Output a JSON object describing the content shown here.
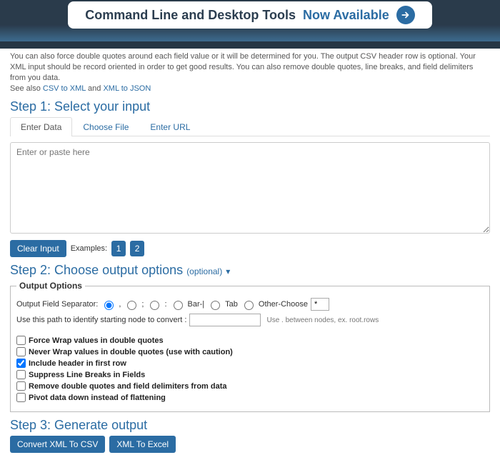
{
  "banner": {
    "text1": "Command Line and Desktop Tools",
    "text2": "Now Available"
  },
  "intro": {
    "line1": "You can also force double quotes around each field value or it will be determined for you. The output CSV header row is optional. Your XML input should be record oriented in order to get good results. You can also remove double quotes, line breaks, and field delimiters from you data.",
    "line2a": "See also ",
    "link1": "CSV to XML",
    "line2b": " and ",
    "link2": "XML to JSON"
  },
  "step1": {
    "title": "Step 1: Select your input"
  },
  "tabs": {
    "enter_data": "Enter Data",
    "choose_file": "Choose File",
    "enter_url": "Enter URL"
  },
  "textarea": {
    "placeholder": "Enter or paste here"
  },
  "controls": {
    "clear_input": "Clear Input",
    "examples_label": "Examples:",
    "ex1": "1",
    "ex2": "2"
  },
  "step2": {
    "title": "Step 2: Choose output options ",
    "optional": "(optional)"
  },
  "options": {
    "legend": "Output Options",
    "separator_label": "Output Field Separator:",
    "sep_comma": ",",
    "sep_semicolon": ";",
    "sep_colon": ":",
    "sep_bar": "Bar-|",
    "sep_tab": "Tab",
    "sep_other": "Other-Choose",
    "other_value": "*",
    "path_label": "Use this path to identify starting node to convert :",
    "path_hint": "Use . between nodes, ex. root.rows",
    "chk_force_wrap": "Force Wrap values in double quotes",
    "chk_never_wrap": "Never Wrap values in double quotes (use with caution)",
    "chk_include_header": "Include header in first row",
    "chk_suppress": "Suppress Line Breaks in Fields",
    "chk_remove": "Remove double quotes and field delimiters from data",
    "chk_pivot": "Pivot data down instead of flattening"
  },
  "step3": {
    "title": "Step 3: Generate output",
    "btn_csv": "Convert XML To CSV",
    "btn_excel": "XML To Excel"
  }
}
